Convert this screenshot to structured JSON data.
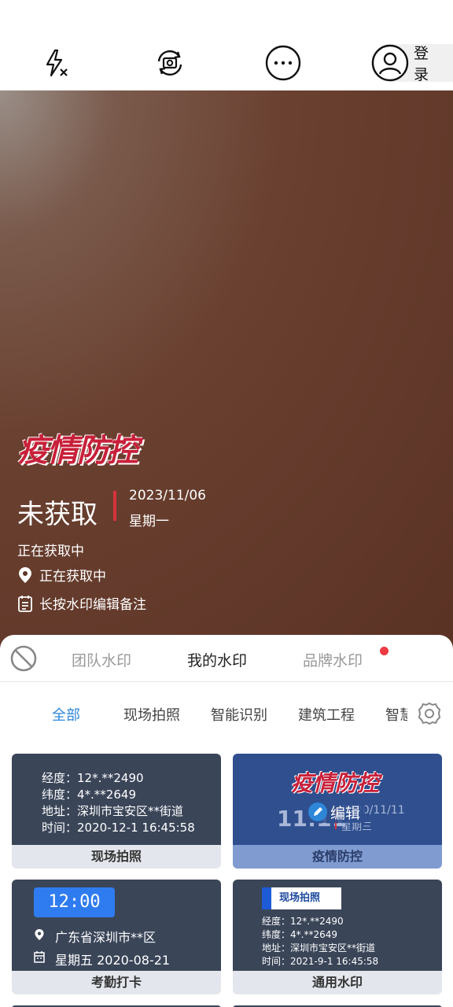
{
  "topbar": {
    "flash_icon": "flash-off-icon",
    "switch_camera_icon": "camera-switch-icon",
    "more_icon": "more-icon",
    "login_label": "登 录"
  },
  "watermark": {
    "logo_text": "疫情防控",
    "status": "未获取",
    "date": "2023/11/06",
    "weekday": "星期一",
    "line1": "正在获取中",
    "location": "正在获取中",
    "note": "长按水印编辑备注"
  },
  "tabs": {
    "items": [
      "团队水印",
      "我的水印",
      "品牌水印"
    ],
    "active": "我的水印"
  },
  "categories": {
    "items": [
      "全部",
      "现场拍照",
      "智能识别",
      "建筑工程",
      "智慧"
    ],
    "active": "全部"
  },
  "cards": [
    {
      "title": "现场拍照",
      "lines": [
        "经度：12*.**2490",
        "纬度：4*.**2649",
        "地址：深圳市宝安区**街道",
        "时间：2020-12-1  16:45:58"
      ]
    },
    {
      "title": "疫情防控",
      "logo": "疫情防控",
      "time": "11:11",
      "date": "2020/11/11",
      "weekday": "星期三",
      "edit_label": "编辑"
    },
    {
      "title": "考勤打卡",
      "clock": "12:00",
      "location": "广东省深圳市**区",
      "date_line": "星期五  2020-08-21"
    },
    {
      "title": "通用水印",
      "badge": "现场拍照",
      "lines": [
        "经度：12*.**2490",
        "纬度：4*.**2649",
        "地址：深圳市宝安区**街道",
        "时间：2021-9-1  16:45:58"
      ]
    }
  ],
  "colors": {
    "accent_blue": "#2e86d8",
    "card_dark": "#3a4558",
    "card_blue": "#2f4f8e",
    "red": "#d6323c"
  }
}
